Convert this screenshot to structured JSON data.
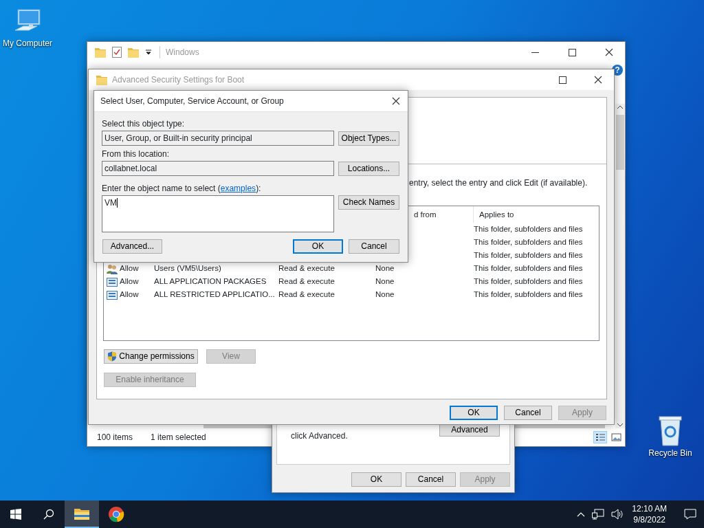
{
  "desktop_icons": [
    {
      "kind": "computer",
      "label": "My Computer"
    },
    {
      "kind": "recycle",
      "label": "Recycle Bin"
    }
  ],
  "explorer": {
    "title": "Windows",
    "help_glyph": "?",
    "status_bar": {
      "item_count": "100 items",
      "selection": "1 item selected"
    },
    "views": [
      {
        "kind": "details",
        "selected": true
      },
      {
        "kind": "thumbnails",
        "selected": false
      }
    ]
  },
  "properties_window": {
    "text": "click Advanced.",
    "advanced_button": "Advanced",
    "buttons": [
      {
        "label": "OK",
        "disabled": false
      },
      {
        "label": "Cancel",
        "disabled": false
      },
      {
        "label": "Apply",
        "disabled": true
      }
    ]
  },
  "security_dialog": {
    "title": "Advanced Security Settings for Boot",
    "instruction": "entry, select the entry and click Edit (if available).",
    "columns": [
      "d from",
      "Applies to"
    ],
    "rows": [
      {
        "applies_to": "This folder, subfolders and files"
      },
      {
        "applies_to": "This folder, subfolders and files"
      },
      {
        "applies_to": "This folder, subfolders and files"
      },
      {
        "kind": "users",
        "type": "Allow",
        "principal": "Users (VM5\\Users)",
        "access": "Read & execute",
        "inherited_from": "None",
        "applies_to": "This folder, subfolders and files"
      },
      {
        "kind": "package",
        "type": "Allow",
        "principal": "ALL APPLICATION PACKAGES",
        "access": "Read & execute",
        "inherited_from": "None",
        "applies_to": "This folder, subfolders and files"
      },
      {
        "kind": "package",
        "type": "Allow",
        "principal": "ALL RESTRICTED APPLICATIO...",
        "access": "Read & execute",
        "inherited_from": "None",
        "applies_to": "This folder, subfolders and files"
      }
    ],
    "actions": [
      {
        "label": "Change permissions",
        "shield": true,
        "disabled": false
      },
      {
        "label": "View",
        "shield": false,
        "disabled": true
      },
      {
        "label": "Enable inheritance",
        "shield": false,
        "disabled": true
      }
    ],
    "buttons": [
      {
        "label": "OK",
        "disabled": false,
        "focused": true
      },
      {
        "label": "Cancel",
        "disabled": false,
        "focused": false
      },
      {
        "label": "Apply",
        "disabled": true,
        "focused": false
      }
    ]
  },
  "select_dialog": {
    "title": "Select User, Computer, Service Account, or Group",
    "object_type_label": "Select this object type:",
    "object_type": "User, Group, or Built-in security principal",
    "object_types_button": "Object Types...",
    "location_label": "From this location:",
    "location": "collabnet.local",
    "locations_button": "Locations...",
    "name_label_start": "Enter the object name to select (",
    "examples_link": "examples",
    "name_label_end": "):",
    "name_value": "VM",
    "check_names_button": "Check Names",
    "advanced_button": "Advanced...",
    "buttons": [
      {
        "label": "OK",
        "focused": true
      },
      {
        "label": "Cancel",
        "focused": false
      }
    ]
  },
  "taskbar": {
    "apps": [
      {
        "kind": "explorer",
        "selected": true
      },
      {
        "kind": "browser",
        "selected": false
      }
    ],
    "time": "12:10 AM",
    "date": "9/8/2022"
  }
}
